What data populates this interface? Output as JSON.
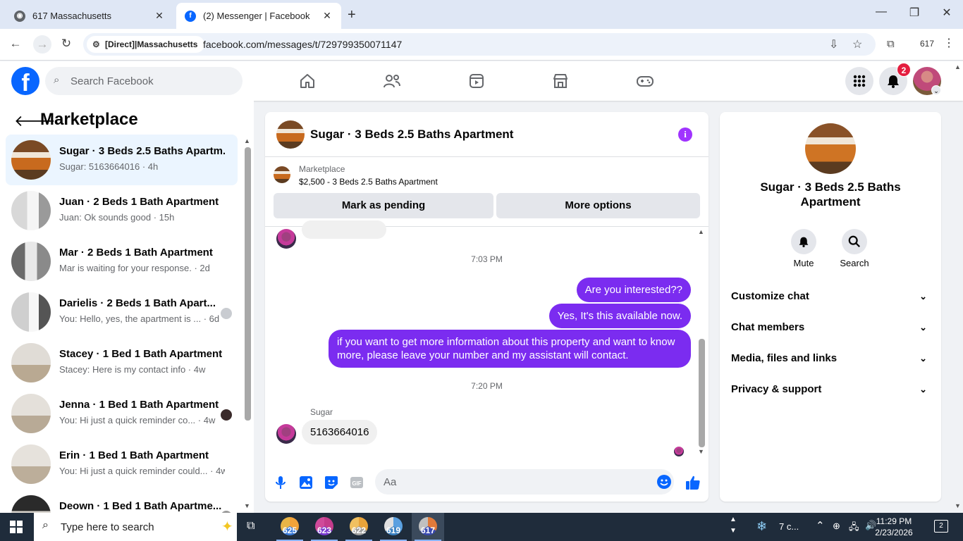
{
  "browser": {
    "tabs": [
      {
        "title": "617 Massachusetts",
        "icon": "globe-icon"
      },
      {
        "title": "(2) Messenger | Facebook",
        "icon": "facebook-icon"
      }
    ],
    "site_chip": "[Direct]|Massachusetts",
    "url": "facebook.com/messages/t/729799350071147",
    "profile_label": "617"
  },
  "header": {
    "search_placeholder": "Search Facebook",
    "notification_count": "2",
    "nav_icons": [
      "home-icon",
      "friends-icon",
      "video-icon",
      "marketplace-icon",
      "gaming-icon"
    ]
  },
  "sidebar": {
    "title": "Marketplace",
    "conversations": [
      {
        "title": "Sugar · 3 Beds 2.5 Baths Apartm...",
        "subtitle": "Sugar: 5163664016 · 4h",
        "active": true
      },
      {
        "title": "Juan · 2 Beds 1 Bath Apartment",
        "subtitle": "Juan: Ok sounds good · 15h"
      },
      {
        "title": "Mar · 2 Beds 1 Bath Apartment",
        "subtitle": "Mar is waiting for your response. · 2d"
      },
      {
        "title": "Darielis · 2 Beds 1 Bath Apart...",
        "subtitle": "You: Hello, yes, the apartment is ... · 6d"
      },
      {
        "title": "Stacey · 1 Bed 1 Bath Apartment",
        "subtitle": "Stacey: Here is my contact info · 4w"
      },
      {
        "title": "Jenna · 1 Bed 1 Bath Apartment",
        "subtitle": "You: Hi just a quick reminder co... · 4w"
      },
      {
        "title": "Erin · 1 Bed 1 Bath Apartment",
        "subtitle": "You: Hi just a quick reminder could... · 4w"
      },
      {
        "title": "Deown · 1 Bed 1 Bath Apartme...",
        "subtitle": ""
      }
    ]
  },
  "chat": {
    "name": "Sugar · 3 Beds 2.5 Baths Apartment",
    "marketplace_label": "Marketplace",
    "listing": "$2,500 - 3 Beds 2.5 Baths Apartment",
    "mark_pending_label": "Mark as pending",
    "more_options_label": "More options",
    "timestamp1": "7:03 PM",
    "outgoing": [
      "Are you interested??",
      "Yes, It's this available now.",
      "if you want to get more information about this property and want to know more, please leave your number and my assistant will contact."
    ],
    "timestamp2": "7:20 PM",
    "sender_name": "Sugar",
    "incoming": "5163664016",
    "composer_placeholder": "Aa"
  },
  "right_panel": {
    "name": "Sugar · 3 Beds 2.5 Baths Apartment",
    "mute_label": "Mute",
    "search_label": "Search",
    "sections": [
      "Customize chat",
      "Chat members",
      "Media, files and links",
      "Privacy & support"
    ]
  },
  "taskbar": {
    "search_placeholder": "Type here to search",
    "apps": [
      "625",
      "623",
      "622",
      "619",
      "617"
    ],
    "weather": "7 c...",
    "time": "11:29 PM",
    "date": "2/23/2026",
    "notifications": "2"
  },
  "colors": {
    "facebook_blue": "#0866ff",
    "messenger_purple": "#7b2cf0",
    "active_conv_bg": "#ebf5ff",
    "taskbar_bg": "#1f2c3b"
  }
}
